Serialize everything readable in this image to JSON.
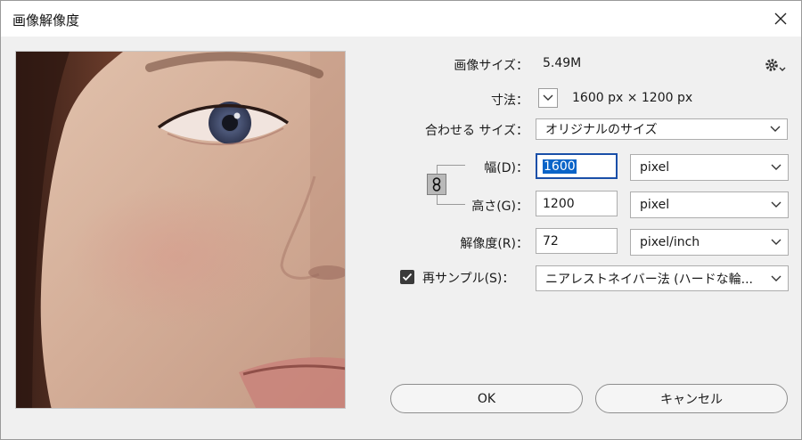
{
  "window": {
    "title": "画像解像度"
  },
  "info": {
    "image_size_label": "画像サイズ：",
    "image_size_value": "5.49M",
    "dimensions_label": "寸法：",
    "dimensions_value": "1600 px × 1200 px"
  },
  "fit_to": {
    "label": "合わせる サイズ：",
    "value": "オリジナルのサイズ"
  },
  "width": {
    "label": "幅(D)：",
    "value": "1600",
    "unit": "pixel"
  },
  "height": {
    "label": "高さ(G)：",
    "value": "1200",
    "unit": "pixel"
  },
  "resolution": {
    "label": "解像度(R)：",
    "value": "72",
    "unit": "pixel/inch"
  },
  "resample": {
    "label": "再サンプル(S)：",
    "checked": true,
    "method": "ニアレストネイバー法 (ハードな輪..."
  },
  "buttons": {
    "ok": "OK",
    "cancel": "キャンセル"
  },
  "colors": {
    "accent": "#0a64c8",
    "focus_border": "#1a4fa8"
  },
  "icons": [
    "close-icon",
    "gear-icon",
    "chevron-down-icon",
    "link-icon",
    "checkmark-icon"
  ]
}
